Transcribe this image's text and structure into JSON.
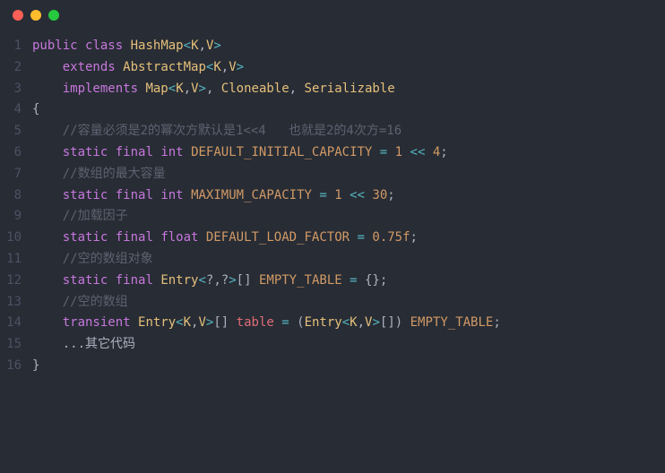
{
  "titlebar": {
    "dots": [
      "red",
      "yellow",
      "green"
    ]
  },
  "code": {
    "lines": [
      {
        "n": "1",
        "tokens": [
          [
            "kw",
            "public"
          ],
          [
            "plain",
            " "
          ],
          [
            "kw",
            "class"
          ],
          [
            "plain",
            " "
          ],
          [
            "type",
            "HashMap"
          ],
          [
            "angleb",
            "<"
          ],
          [
            "type",
            "K"
          ],
          [
            "punc",
            ","
          ],
          [
            "type",
            "V"
          ],
          [
            "angleb",
            ">"
          ]
        ]
      },
      {
        "n": "2",
        "tokens": [
          [
            "plain",
            "    "
          ],
          [
            "kw",
            "extends"
          ],
          [
            "plain",
            " "
          ],
          [
            "type",
            "AbstractMap"
          ],
          [
            "angleb",
            "<"
          ],
          [
            "type",
            "K"
          ],
          [
            "punc",
            ","
          ],
          [
            "type",
            "V"
          ],
          [
            "angleb",
            ">"
          ]
        ]
      },
      {
        "n": "3",
        "tokens": [
          [
            "plain",
            "    "
          ],
          [
            "kw",
            "implements"
          ],
          [
            "plain",
            " "
          ],
          [
            "type",
            "Map"
          ],
          [
            "angleb",
            "<"
          ],
          [
            "type",
            "K"
          ],
          [
            "punc",
            ","
          ],
          [
            "type",
            "V"
          ],
          [
            "angleb",
            ">"
          ],
          [
            "punc",
            ", "
          ],
          [
            "type",
            "Cloneable"
          ],
          [
            "punc",
            ", "
          ],
          [
            "type",
            "Serializable"
          ]
        ]
      },
      {
        "n": "4",
        "tokens": [
          [
            "punc",
            "{"
          ]
        ]
      },
      {
        "n": "5",
        "tokens": [
          [
            "plain",
            "    "
          ],
          [
            "comment",
            "//容量必须是2的幂次方默认是1<<4   也就是2的4次方=16"
          ]
        ]
      },
      {
        "n": "6",
        "tokens": [
          [
            "plain",
            "    "
          ],
          [
            "kw",
            "static"
          ],
          [
            "plain",
            " "
          ],
          [
            "kw",
            "final"
          ],
          [
            "plain",
            " "
          ],
          [
            "kw",
            "int"
          ],
          [
            "plain",
            " "
          ],
          [
            "const",
            "DEFAULT_INITIAL_CAPACITY"
          ],
          [
            "plain",
            " "
          ],
          [
            "op",
            "="
          ],
          [
            "plain",
            " "
          ],
          [
            "num",
            "1"
          ],
          [
            "plain",
            " "
          ],
          [
            "op",
            "<<"
          ],
          [
            "plain",
            " "
          ],
          [
            "num",
            "4"
          ],
          [
            "punc",
            ";"
          ]
        ]
      },
      {
        "n": "7",
        "tokens": [
          [
            "plain",
            "    "
          ],
          [
            "comment",
            "//数组的最大容量"
          ]
        ]
      },
      {
        "n": "8",
        "tokens": [
          [
            "plain",
            "    "
          ],
          [
            "kw",
            "static"
          ],
          [
            "plain",
            " "
          ],
          [
            "kw",
            "final"
          ],
          [
            "plain",
            " "
          ],
          [
            "kw",
            "int"
          ],
          [
            "plain",
            " "
          ],
          [
            "const",
            "MAXIMUM_CAPACITY"
          ],
          [
            "plain",
            " "
          ],
          [
            "op",
            "="
          ],
          [
            "plain",
            " "
          ],
          [
            "num",
            "1"
          ],
          [
            "plain",
            " "
          ],
          [
            "op",
            "<<"
          ],
          [
            "plain",
            " "
          ],
          [
            "num",
            "30"
          ],
          [
            "punc",
            ";"
          ]
        ]
      },
      {
        "n": "9",
        "tokens": [
          [
            "plain",
            "    "
          ],
          [
            "comment",
            "//加载因子"
          ]
        ]
      },
      {
        "n": "10",
        "tokens": [
          [
            "plain",
            "    "
          ],
          [
            "kw",
            "static"
          ],
          [
            "plain",
            " "
          ],
          [
            "kw",
            "final"
          ],
          [
            "plain",
            " "
          ],
          [
            "kw",
            "float"
          ],
          [
            "plain",
            " "
          ],
          [
            "const",
            "DEFAULT_LOAD_FACTOR"
          ],
          [
            "plain",
            " "
          ],
          [
            "op",
            "="
          ],
          [
            "plain",
            " "
          ],
          [
            "num",
            "0.75f"
          ],
          [
            "punc",
            ";"
          ]
        ]
      },
      {
        "n": "11",
        "tokens": [
          [
            "plain",
            "    "
          ],
          [
            "comment",
            "//空的数组对象"
          ]
        ]
      },
      {
        "n": "12",
        "tokens": [
          [
            "plain",
            "    "
          ],
          [
            "kw",
            "static"
          ],
          [
            "plain",
            " "
          ],
          [
            "kw",
            "final"
          ],
          [
            "plain",
            " "
          ],
          [
            "type",
            "Entry"
          ],
          [
            "angleb",
            "<"
          ],
          [
            "punc",
            "?"
          ],
          [
            "punc",
            ","
          ],
          [
            "punc",
            "?"
          ],
          [
            "angleb",
            ">"
          ],
          [
            "punc",
            "[] "
          ],
          [
            "const",
            "EMPTY_TABLE"
          ],
          [
            "plain",
            " "
          ],
          [
            "op",
            "="
          ],
          [
            "plain",
            " "
          ],
          [
            "punc",
            "{};"
          ]
        ]
      },
      {
        "n": "13",
        "tokens": [
          [
            "plain",
            "    "
          ],
          [
            "comment",
            "//空的数组"
          ]
        ]
      },
      {
        "n": "14",
        "tokens": [
          [
            "plain",
            "    "
          ],
          [
            "kw",
            "transient"
          ],
          [
            "plain",
            " "
          ],
          [
            "type",
            "Entry"
          ],
          [
            "angleb",
            "<"
          ],
          [
            "type",
            "K"
          ],
          [
            "punc",
            ","
          ],
          [
            "type",
            "V"
          ],
          [
            "angleb",
            ">"
          ],
          [
            "punc",
            "[] "
          ],
          [
            "ident",
            "table"
          ],
          [
            "plain",
            " "
          ],
          [
            "op",
            "="
          ],
          [
            "plain",
            " "
          ],
          [
            "punc",
            "("
          ],
          [
            "type",
            "Entry"
          ],
          [
            "angleb",
            "<"
          ],
          [
            "type",
            "K"
          ],
          [
            "punc",
            ","
          ],
          [
            "type",
            "V"
          ],
          [
            "angleb",
            ">"
          ],
          [
            "punc",
            "[]) "
          ],
          [
            "const",
            "EMPTY_TABLE"
          ],
          [
            "punc",
            ";"
          ]
        ]
      },
      {
        "n": "15",
        "tokens": [
          [
            "plain",
            "    "
          ],
          [
            "plain",
            "...其它代码"
          ]
        ]
      },
      {
        "n": "16",
        "tokens": [
          [
            "punc",
            "}"
          ]
        ]
      }
    ]
  }
}
